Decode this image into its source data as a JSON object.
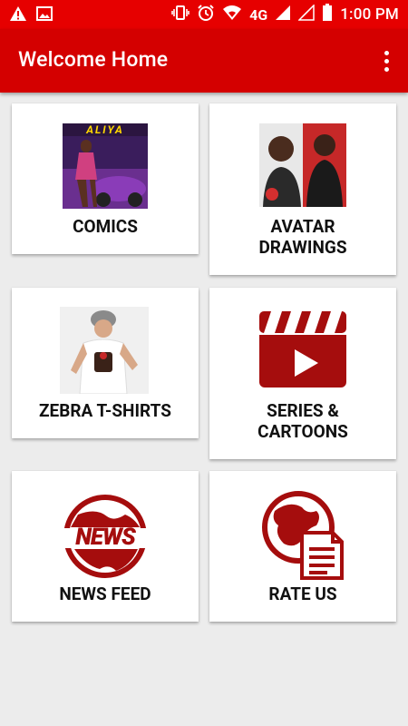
{
  "status_bar": {
    "time": "1:00 PM",
    "network": "4G",
    "icons": [
      "warning-icon",
      "image-icon",
      "vibrate-icon",
      "alarm-icon",
      "wifi-icon",
      "signal-icon",
      "signal-empty-icon",
      "battery-icon"
    ]
  },
  "app_bar": {
    "title": "Welcome Home",
    "menu_icon": "more-vert-icon"
  },
  "cards": [
    {
      "label": "COMICS",
      "image": "comic-cover-aliya",
      "image_text": "ALIYA"
    },
    {
      "label": "AVATAR\nDRAWINGS",
      "image": "avatar-drawing-photo"
    },
    {
      "label": "ZEBRA T-SHIRTS",
      "image": "tshirt-model-photo"
    },
    {
      "label": "SERIES &\nCARTOONS",
      "image": "clapperboard-play-icon"
    },
    {
      "label": "NEWS FEED",
      "image": "news-globe-icon",
      "image_text": "NEWS"
    },
    {
      "label": "RATE US",
      "image": "globe-document-icon"
    }
  ],
  "colors": {
    "status_bar": "#e60000",
    "app_bar": "#d40000",
    "icon_red": "#a50d0d",
    "background": "#ececec"
  }
}
